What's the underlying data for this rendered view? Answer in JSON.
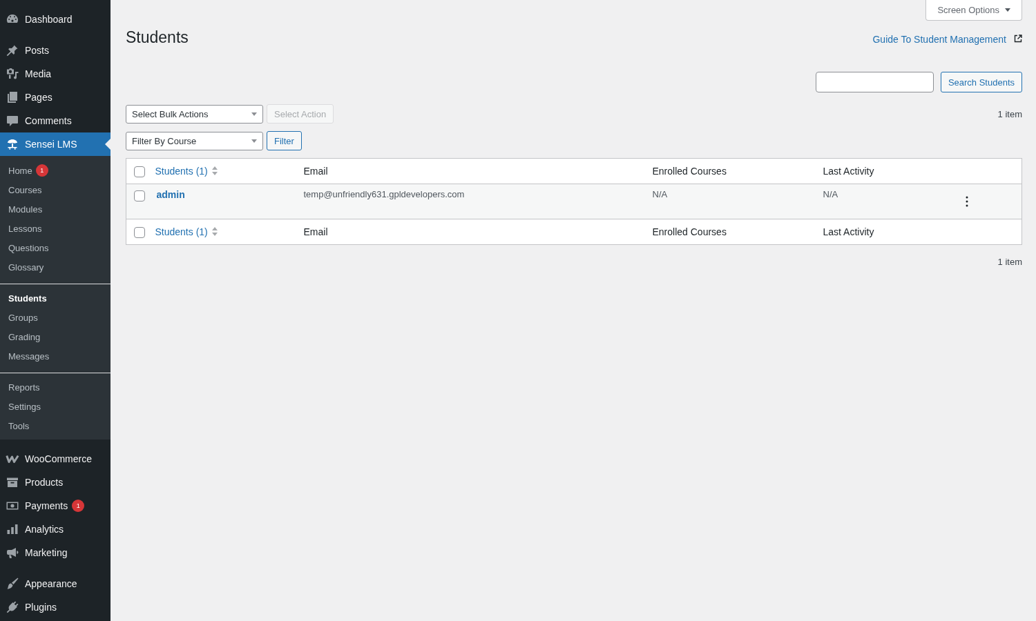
{
  "sidebar": {
    "groups": [
      {
        "items": [
          {
            "label": "Dashboard",
            "selected": false
          }
        ]
      },
      {
        "items": [
          {
            "label": "Posts",
            "selected": false
          },
          {
            "label": "Media",
            "selected": false
          },
          {
            "label": "Pages",
            "selected": false
          },
          {
            "label": "Comments",
            "selected": false
          },
          {
            "label": "Sensei LMS",
            "selected": true,
            "submenu": [
              {
                "items": [
                  {
                    "label": "Home",
                    "selected": false,
                    "badge": "1"
                  },
                  {
                    "label": "Courses",
                    "selected": false
                  },
                  {
                    "label": "Modules",
                    "selected": false
                  },
                  {
                    "label": "Lessons",
                    "selected": false
                  },
                  {
                    "label": "Questions",
                    "selected": false
                  },
                  {
                    "label": "Glossary",
                    "selected": false
                  }
                ]
              },
              {
                "items": [
                  {
                    "label": "Students",
                    "selected": true
                  },
                  {
                    "label": "Groups",
                    "selected": false
                  },
                  {
                    "label": "Grading",
                    "selected": false
                  },
                  {
                    "label": "Messages",
                    "selected": false
                  }
                ]
              },
              {
                "items": [
                  {
                    "label": "Reports",
                    "selected": false
                  },
                  {
                    "label": "Settings",
                    "selected": false
                  },
                  {
                    "label": "Tools",
                    "selected": false
                  }
                ]
              }
            ]
          }
        ]
      },
      {
        "items": [
          {
            "label": "WooCommerce",
            "selected": false
          },
          {
            "label": "Products",
            "selected": false
          },
          {
            "label": "Payments",
            "selected": false,
            "badge": "1"
          },
          {
            "label": "Analytics",
            "selected": false
          },
          {
            "label": "Marketing",
            "selected": false
          }
        ]
      },
      {
        "items": [
          {
            "label": "Appearance",
            "selected": false
          },
          {
            "label": "Plugins",
            "selected": false
          }
        ]
      }
    ]
  },
  "screen_options": {
    "label": "Screen Options"
  },
  "page_title": "Students",
  "guide_link": "Guide To Student Management",
  "search": {
    "button": "Search Students"
  },
  "bulk_actions": {
    "select": "Select Bulk Actions",
    "button": {
      "label": "Select Action",
      "disabled": true
    }
  },
  "item_count_top": "1 item",
  "filter": {
    "select": "Filter By Course",
    "button": {
      "label": "Filter",
      "disabled": false
    }
  },
  "table": {
    "header_checked": false,
    "columns": [
      {
        "label": "Students (1)",
        "sortable": true
      },
      {
        "label": "Email",
        "sortable": false
      },
      {
        "label": "Enrolled Courses",
        "sortable": false
      },
      {
        "label": "Last Activity",
        "sortable": false
      }
    ],
    "rows": [
      {
        "checked": false,
        "name": "admin",
        "email": "temp@unfriendly631.gpldevelopers.com",
        "enrolled_courses": "N/A",
        "last_activity": "N/A"
      }
    ],
    "footer_checked": false,
    "footer_columns": [
      {
        "label": "Students (1)",
        "sortable": true
      },
      {
        "label": "Email",
        "sortable": false
      },
      {
        "label": "Enrolled Courses",
        "sortable": false
      },
      {
        "label": "Last Activity",
        "sortable": false
      }
    ]
  },
  "item_count_bottom": "1 item"
}
